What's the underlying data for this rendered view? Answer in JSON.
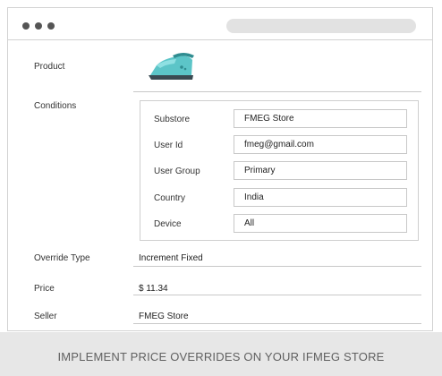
{
  "product": {
    "label": "Product",
    "image_icon": "iron-icon"
  },
  "conditions": {
    "label": "Conditions",
    "rows": [
      {
        "label": "Substore",
        "value": "FMEG Store"
      },
      {
        "label": "User Id",
        "value": "fmeg@gmail.com"
      },
      {
        "label": "User Group",
        "value": "Primary"
      },
      {
        "label": "Country",
        "value": "India"
      },
      {
        "label": "Device",
        "value": "All"
      }
    ]
  },
  "override_type": {
    "label": "Override Type",
    "value": "Increment Fixed"
  },
  "price": {
    "label": "Price",
    "value": "$ 11.34"
  },
  "seller": {
    "label": "Seller",
    "value": "FMEG Store"
  },
  "footer": {
    "text": "IMPLEMENT PRICE OVERRIDES ON YOUR IFMEG STORE"
  },
  "colors": {
    "accent": "#5cc5c8",
    "footer_bg": "#e7e7e7"
  }
}
